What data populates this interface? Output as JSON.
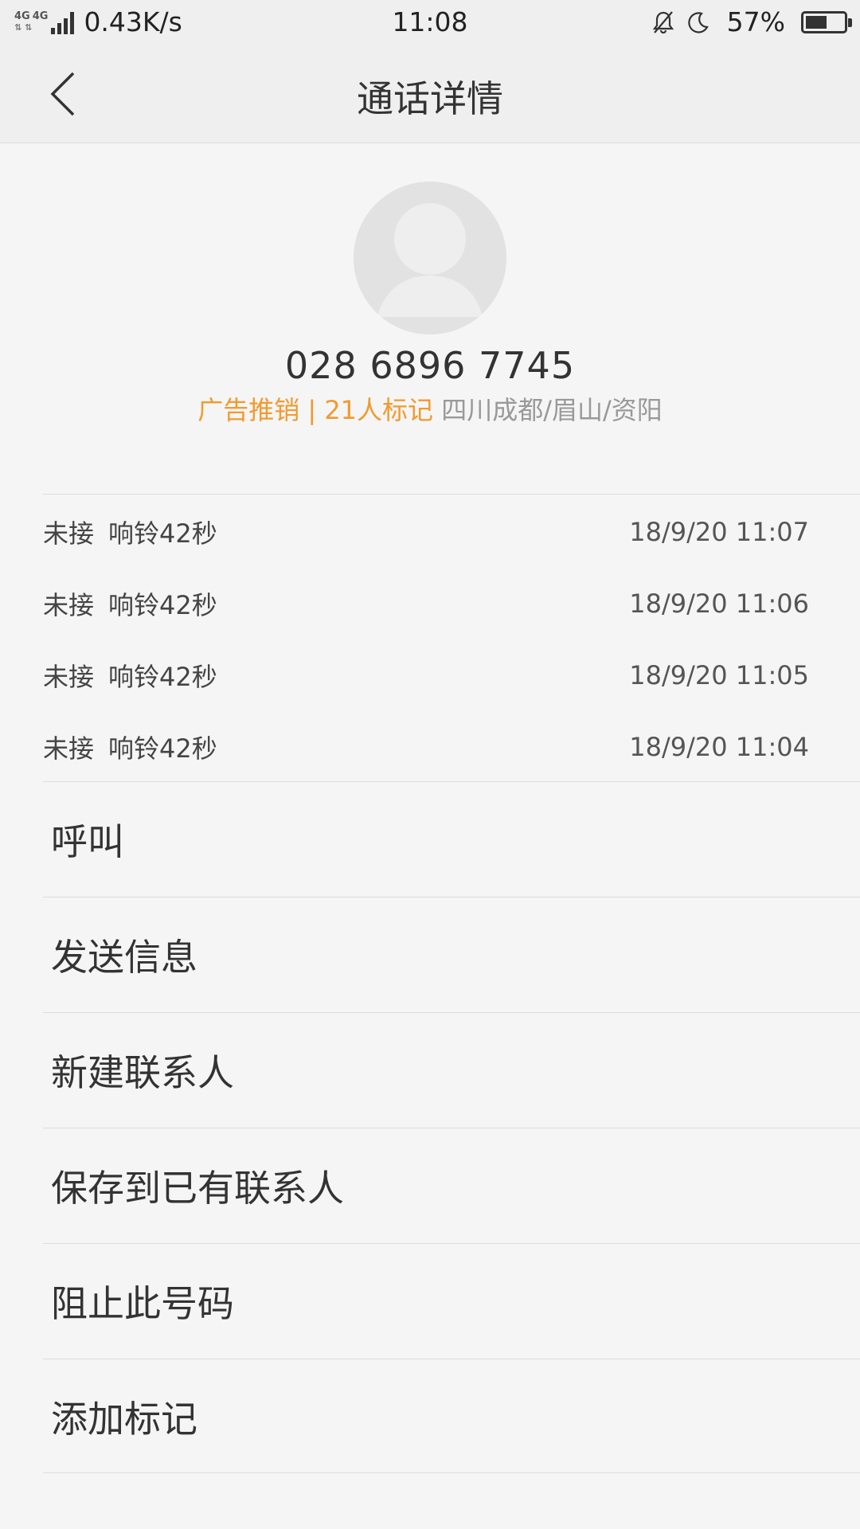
{
  "status_bar": {
    "network_type_1": "4G",
    "network_type_2": "4G",
    "speed": "0.43K/s",
    "time": "11:08",
    "battery_percent": "57%",
    "battery_level": 0.57,
    "icons": [
      "silent-bell-icon",
      "moon-icon",
      "battery-icon"
    ]
  },
  "header": {
    "title": "通话详情",
    "back_icon": "back-arrow-icon"
  },
  "contact": {
    "avatar_icon": "default-avatar-icon",
    "number": "028 6896 7745",
    "tag": "广告推销 | 21人标记",
    "location": "四川成都/眉山/资阳"
  },
  "call_log": [
    {
      "status": "未接",
      "detail": "响铃42秒",
      "time": "18/9/20 11:07"
    },
    {
      "status": "未接",
      "detail": "响铃42秒",
      "time": "18/9/20 11:06"
    },
    {
      "status": "未接",
      "detail": "响铃42秒",
      "time": "18/9/20 11:05"
    },
    {
      "status": "未接",
      "detail": "响铃42秒",
      "time": "18/9/20 11:04"
    }
  ],
  "actions": [
    {
      "label": "呼叫"
    },
    {
      "label": "发送信息"
    },
    {
      "label": "新建联系人"
    },
    {
      "label": "保存到已有联系人"
    },
    {
      "label": "阻止此号码"
    },
    {
      "label": "添加标记"
    }
  ],
  "colors": {
    "accent": "#f29a2e",
    "background": "#f5f5f5",
    "header_background": "#efefef"
  }
}
